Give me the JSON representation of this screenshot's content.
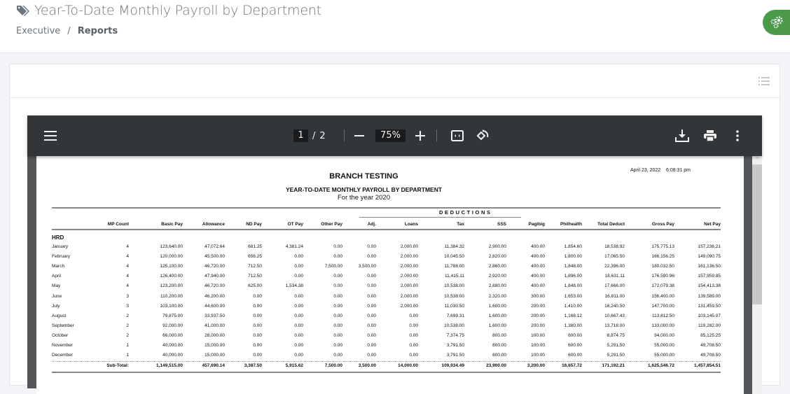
{
  "header": {
    "title": "Year-To-Date Monthly Payroll by Department",
    "title_icon": "tags-icon",
    "breadcrumb": [
      {
        "label": "Executive"
      },
      {
        "label": "/"
      },
      {
        "label": "Reports"
      }
    ],
    "settings_icon": "gears-icon",
    "settings_color": "#4a9a4a"
  },
  "card": {
    "header_icon": "list-icon"
  },
  "pdf_toolbar": {
    "menu_icon": "hamburger-icon",
    "current_page": "1",
    "page_separator": "/",
    "total_pages": "2",
    "zoom_out_icon": "minus-icon",
    "zoom_level": "75%",
    "zoom_in_icon": "plus-icon",
    "fit_icon": "fit-to-page-icon",
    "rotate_icon": "rotate-icon",
    "download_icon": "download-icon",
    "print_icon": "print-icon",
    "more_icon": "more-vertical-icon"
  },
  "report": {
    "timestamp": "April 23, 2022    6:08:31 pm",
    "branch": "BRANCH TESTING",
    "title": "YEAR-TO-DATE MONTHLY PAYROLL BY DEPARTMENT",
    "subtitle": "For the year 2020",
    "deductions_label": "DEDUCTIONS",
    "columns": [
      "MP Count",
      "Basic Pay",
      "Allowance",
      "ND Pay",
      "OT Pay",
      "Other Pay",
      "Adj.",
      "Loans",
      "Tax",
      "SSS",
      "Pagibig",
      "Philhealth",
      "Total Deduct",
      "Gross Pay",
      "Net Pay"
    ],
    "department": "HRD",
    "rows": [
      {
        "month": "January",
        "values": [
          "4",
          "123,640.00",
          "47,072.64",
          "681.25",
          "4,381.24",
          "0.00",
          "0.00",
          "2,000.00",
          "11,384.32",
          "2,900.00",
          "400.00",
          "1,854.60",
          "18,538.92",
          "175,775.13",
          "157,236.21"
        ]
      },
      {
        "month": "February",
        "values": [
          "4",
          "120,000.00",
          "45,500.00",
          "656.25",
          "0.00",
          "0.00",
          "0.00",
          "2,000.00",
          "10,045.50",
          "2,820.00",
          "400.00",
          "1,800.00",
          "17,065.50",
          "166,156.25",
          "149,090.75"
        ]
      },
      {
        "month": "March",
        "values": [
          "4",
          "125,100.00",
          "46,720.00",
          "712.50",
          "0.00",
          "7,500.00",
          "3,500.00",
          "2,000.00",
          "11,788.00",
          "2,860.00",
          "400.00",
          "1,848.00",
          "22,396.00",
          "180,032.50",
          "161,136.50"
        ]
      },
      {
        "month": "April",
        "values": [
          "4",
          "126,400.00",
          "47,940.00",
          "712.50",
          "0.00",
          "0.00",
          "0.00",
          "2,000.00",
          "11,415.11",
          "2,920.00",
          "400.00",
          "1,896.00",
          "18,631.11",
          "176,590.96",
          "157,959.85"
        ]
      },
      {
        "month": "May",
        "values": [
          "4",
          "123,200.00",
          "46,720.00",
          "625.00",
          "1,534.38",
          "0.00",
          "0.00",
          "2,000.00",
          "10,538.00",
          "2,880.00",
          "400.00",
          "1,848.00",
          "17,666.00",
          "172,079.38",
          "154,413.38"
        ]
      },
      {
        "month": "June",
        "values": [
          "3",
          "110,200.00",
          "46,200.00",
          "0.00",
          "0.00",
          "0.00",
          "0.00",
          "2,000.00",
          "10,538.00",
          "2,320.00",
          "300.00",
          "1,653.00",
          "16,811.00",
          "156,400.00",
          "139,589.00"
        ]
      },
      {
        "month": "July",
        "values": [
          "3",
          "103,100.00",
          "44,600.00",
          "0.00",
          "0.00",
          "0.00",
          "0.00",
          "2,000.00",
          "11,030.50",
          "1,600.00",
          "200.00",
          "1,410.00",
          "16,240.50",
          "147,700.00",
          "131,459.50"
        ]
      },
      {
        "month": "August",
        "values": [
          "2",
          "79,875.00",
          "33,937.50",
          "0.00",
          "0.00",
          "0.00",
          "0.00",
          "0.00",
          "7,699.31",
          "1,600.00",
          "200.00",
          "1,168.12",
          "10,667.43",
          "113,812.50",
          "103,145.07"
        ]
      },
      {
        "month": "September",
        "values": [
          "2",
          "92,000.00",
          "41,000.00",
          "0.00",
          "0.00",
          "0.00",
          "0.00",
          "0.00",
          "10,538.00",
          "1,600.00",
          "200.00",
          "1,380.00",
          "13,718.00",
          "133,000.00",
          "119,282.00"
        ]
      },
      {
        "month": "October",
        "values": [
          "2",
          "66,000.00",
          "28,000.00",
          "0.00",
          "0.00",
          "0.00",
          "0.00",
          "0.00",
          "7,374.75",
          "800.00",
          "100.00",
          "600.00",
          "8,874.75",
          "94,000.00",
          "85,125.25"
        ]
      },
      {
        "month": "November",
        "values": [
          "1",
          "40,000.00",
          "15,000.00",
          "0.00",
          "0.00",
          "0.00",
          "0.00",
          "0.00",
          "3,791.50",
          "800.00",
          "100.00",
          "600.00",
          "5,291.50",
          "55,000.00",
          "49,708.50"
        ]
      },
      {
        "month": "December",
        "values": [
          "1",
          "40,000.00",
          "15,000.00",
          "0.00",
          "0.00",
          "0.00",
          "0.00",
          "0.00",
          "3,791.50",
          "800.00",
          "100.00",
          "600.00",
          "5,291.50",
          "55,000.00",
          "49,708.50"
        ]
      }
    ],
    "subtotal": {
      "label": "Sub-Total:",
      "values": [
        "1,149,515.00",
        "457,690.14",
        "3,387.50",
        "5,915.62",
        "7,500.00",
        "3,500.00",
        "14,000.00",
        "109,934.49",
        "23,900.00",
        "3,200.00",
        "16,657.72",
        "171,192.21",
        "1,625,546.72",
        "1,457,854.51"
      ]
    }
  }
}
